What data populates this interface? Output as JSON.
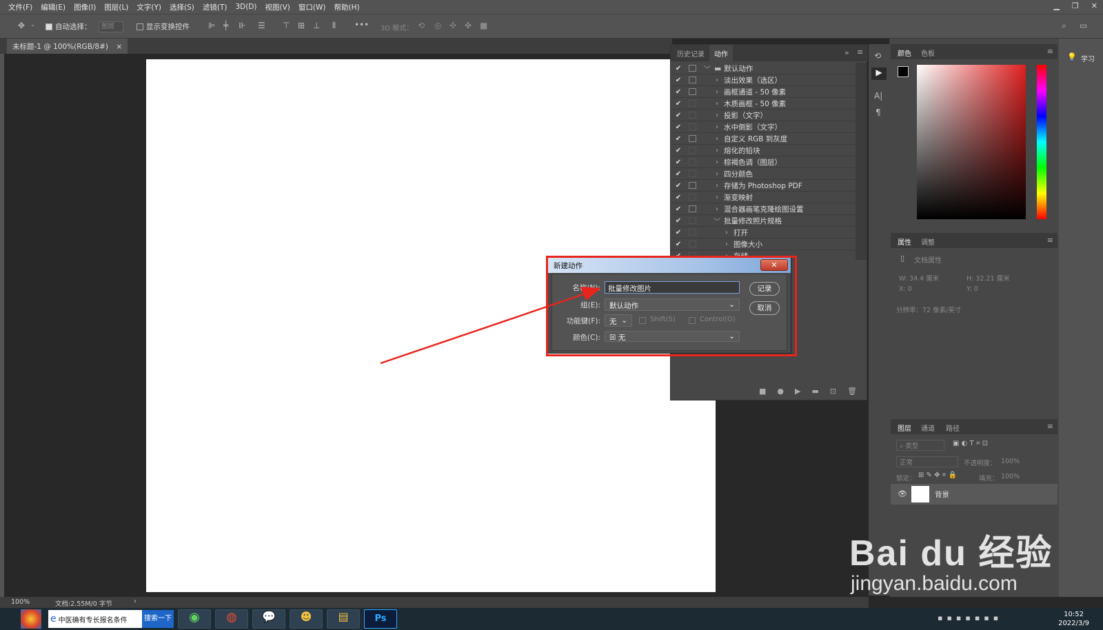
{
  "menu": [
    "文件(F)",
    "编辑(E)",
    "图像(I)",
    "图层(L)",
    "文字(Y)",
    "选择(S)",
    "滤镜(T)",
    "3D(D)",
    "视图(V)",
    "窗口(W)",
    "帮助(H)"
  ],
  "options": {
    "auto_select": "自动选择：",
    "layer_select": "图层",
    "show_transform": "显示变换控件",
    "mode_3d": "3D 模式："
  },
  "doc_tab": "未标题-1 @ 100%(RGB/8#)",
  "status": {
    "zoom": "100%",
    "doc": "文档:2.55M/0 字节"
  },
  "actions_panel": {
    "tabs": [
      "历史记录",
      "动作"
    ],
    "items": [
      {
        "label": "默认动作",
        "dlg": true,
        "folder": true,
        "indent": 0,
        "expander": "﹀"
      },
      {
        "label": "淡出效果（选区）",
        "dlg": true,
        "indent": 1,
        "expander": "›"
      },
      {
        "label": "画框通道 - 50 像素",
        "dlg": true,
        "indent": 1,
        "expander": "›"
      },
      {
        "label": "木质画框 - 50 像素",
        "dlg": false,
        "indent": 1,
        "expander": "›"
      },
      {
        "label": "投影（文字）",
        "dlg": false,
        "indent": 1,
        "expander": "›"
      },
      {
        "label": "水中倒影（文字）",
        "dlg": false,
        "indent": 1,
        "expander": "›"
      },
      {
        "label": "自定义 RGB 到灰度",
        "dlg": true,
        "indent": 1,
        "expander": "›"
      },
      {
        "label": "熔化的铅块",
        "dlg": false,
        "indent": 1,
        "expander": "›"
      },
      {
        "label": "棕褐色调（图层）",
        "dlg": false,
        "indent": 1,
        "expander": "›"
      },
      {
        "label": "四分颜色",
        "dlg": false,
        "indent": 1,
        "expander": "›"
      },
      {
        "label": "存储为 Photoshop PDF",
        "dlg": true,
        "indent": 1,
        "expander": "›"
      },
      {
        "label": "渐变映射",
        "dlg": false,
        "indent": 1,
        "expander": "›"
      },
      {
        "label": "混合器画笔克隆绘图设置",
        "dlg": true,
        "indent": 1,
        "expander": "›"
      },
      {
        "label": "批量修改照片规格",
        "dlg": false,
        "indent": 1,
        "expander": "﹀"
      },
      {
        "label": "打开",
        "dlg": false,
        "indent": 2,
        "expander": "›"
      },
      {
        "label": "图像大小",
        "dlg": false,
        "indent": 2,
        "expander": "›"
      },
      {
        "label": "存储",
        "dlg": false,
        "indent": 2,
        "expander": "›"
      }
    ]
  },
  "color_panel": {
    "tabs": [
      "颜色",
      "色板"
    ],
    "accent": "#e02020"
  },
  "props_panel": {
    "tabs": [
      "属性",
      "调整"
    ],
    "doc_props": "文档属性",
    "w": "W:  34.4 厘米",
    "h": "H:  32.21 厘米",
    "x": "X:  0",
    "y": "Y:  0",
    "res": "分辨率：72 像素/英寸"
  },
  "layers_panel": {
    "tabs": [
      "图层",
      "通道",
      "路径"
    ],
    "kind": "类型",
    "blend": "正常",
    "opacity_label": "不透明度：",
    "opacity": "100%",
    "lock_label": "锁定：",
    "fill_label": "填充：",
    "fill": "100%",
    "layer_name": "背景"
  },
  "learn": "学习",
  "dialog": {
    "title": "新建动作",
    "name_label": "名称(N):",
    "name_value": "批量修改图片",
    "group_label": "组(E):",
    "group_value": "默认动作",
    "fkey_label": "功能键(F):",
    "fkey_value": "无",
    "shift_label": "Shift(S)",
    "control_label": "Control(O)",
    "color_label": "颜色(C):",
    "color_value": "无",
    "record": "记录",
    "cancel": "取消",
    "close": "✕"
  },
  "taskbar": {
    "ie_text": "中医确有专长报名条件",
    "search_btn": "搜索一下",
    "time": "10:52",
    "date": "2022/3/9"
  },
  "watermark": {
    "brand": "Bai du 经验",
    "url": "jingyan.baidu.com"
  }
}
